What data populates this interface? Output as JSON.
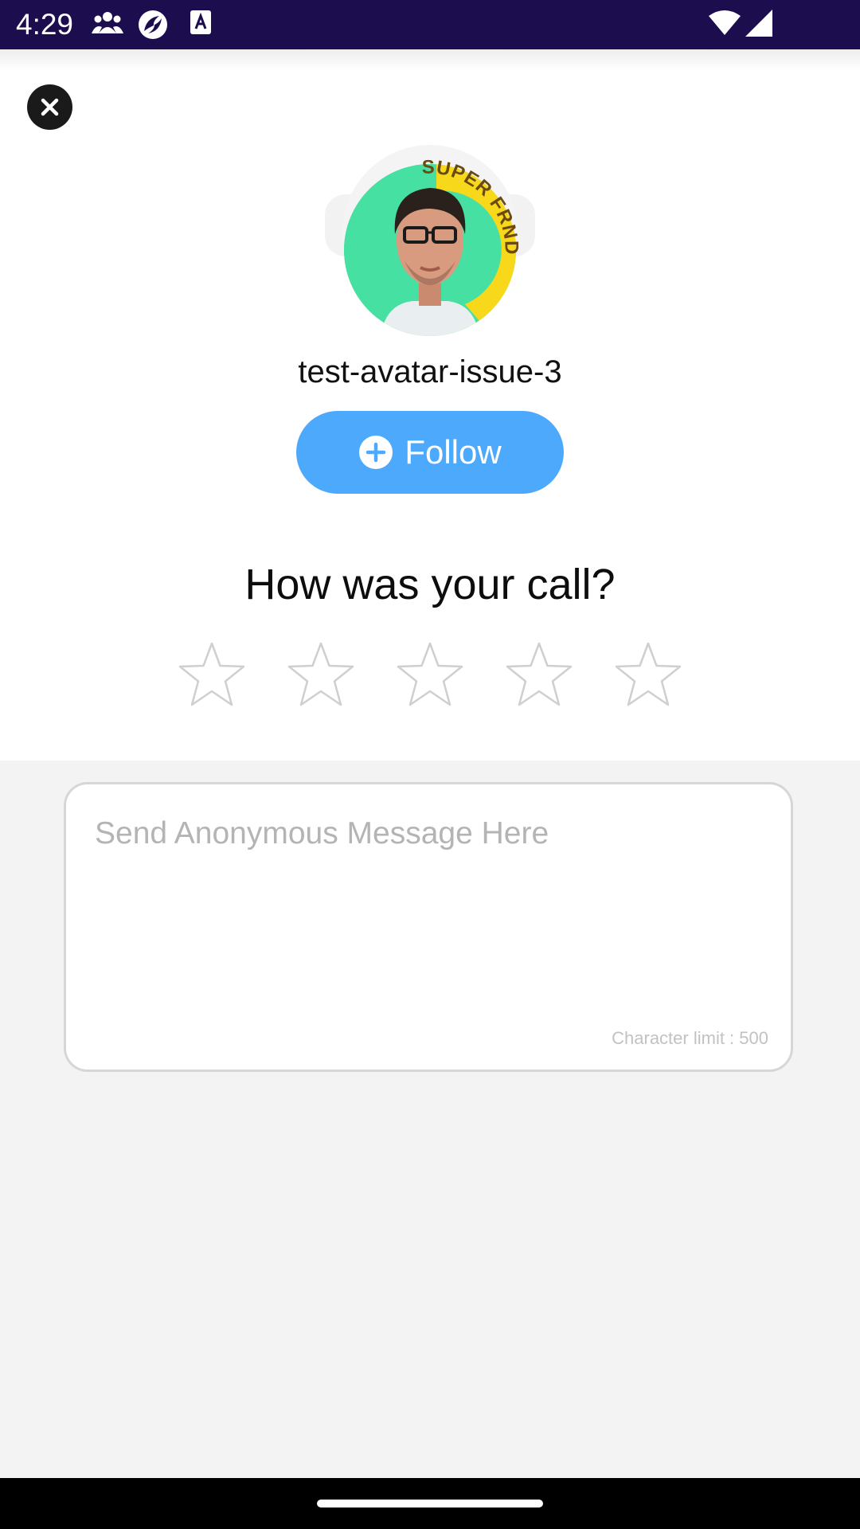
{
  "status_bar": {
    "time": "4:29",
    "icons": [
      "people-icon",
      "app-notification-icon",
      "a-icon",
      "wifi-icon",
      "cellular-signal-icon"
    ]
  },
  "header": {
    "close_icon": "close-icon"
  },
  "profile": {
    "username": "test-avatar-issue-3",
    "badge_text": "SUPER FRND",
    "follow_label": "Follow",
    "follow_icon": "plus-circle-icon",
    "follow_color": "#4da9fb"
  },
  "rating": {
    "title": "How was your call?",
    "stars_total": 5,
    "stars_selected": 0
  },
  "message": {
    "placeholder": "Send Anonymous Message Here",
    "value": "",
    "char_limit_text": "Character limit : 500"
  },
  "colors": {
    "status_bar": "#1c0d4f",
    "follow_button": "#4da9fb",
    "background": "#f3f3f3"
  }
}
